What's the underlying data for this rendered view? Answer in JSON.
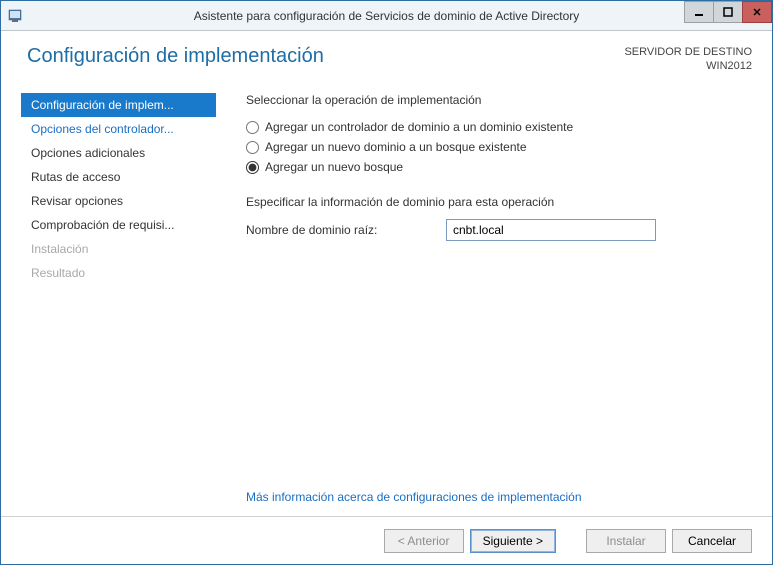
{
  "window": {
    "title": "Asistente para configuración de Servicios de dominio de Active Directory"
  },
  "header": {
    "page_title": "Configuración de implementación",
    "dest_label": "SERVIDOR DE DESTINO",
    "dest_value": "WIN2012"
  },
  "sidebar": {
    "items": [
      {
        "label": "Configuración de implem...",
        "state": "selected"
      },
      {
        "label": "Opciones del controlador...",
        "state": "link"
      },
      {
        "label": "Opciones adicionales",
        "state": "normal"
      },
      {
        "label": "Rutas de acceso",
        "state": "normal"
      },
      {
        "label": "Revisar opciones",
        "state": "normal"
      },
      {
        "label": "Comprobación de requisi...",
        "state": "normal"
      },
      {
        "label": "Instalación",
        "state": "disabled"
      },
      {
        "label": "Resultado",
        "state": "disabled"
      }
    ]
  },
  "main": {
    "select_op_label": "Seleccionar la operación de implementación",
    "radios": [
      {
        "label": "Agregar un controlador de dominio a un dominio existente",
        "checked": false
      },
      {
        "label": "Agregar un nuevo dominio a un bosque existente",
        "checked": false
      },
      {
        "label": "Agregar un nuevo bosque",
        "checked": true
      }
    ],
    "specify_label": "Especificar la información de dominio para esta operación",
    "root_domain_label": "Nombre de dominio raíz:",
    "root_domain_value": "cnbt.local",
    "more_info": "Más información acerca de configuraciones de implementación"
  },
  "footer": {
    "previous": "< Anterior",
    "next": "Siguiente >",
    "install": "Instalar",
    "cancel": "Cancelar"
  }
}
